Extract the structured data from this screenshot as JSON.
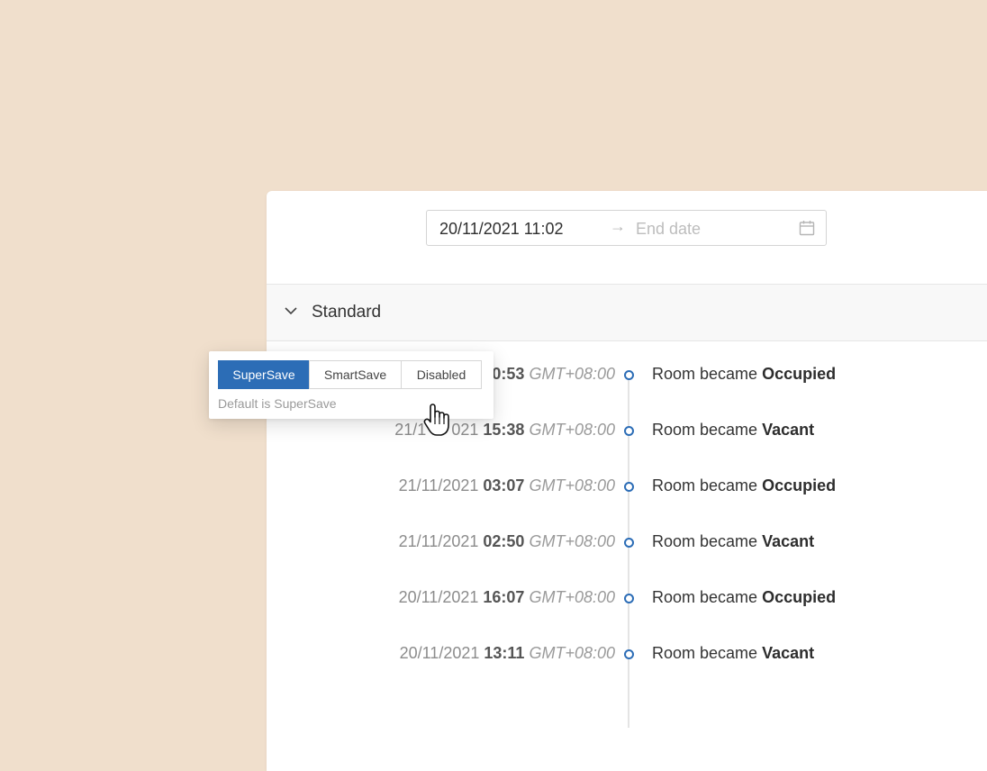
{
  "date_range": {
    "start_value": "20/11/2021 11:02",
    "arrow_glyph": "→",
    "end_placeholder": "End date",
    "calendar_icon": "calendar-icon"
  },
  "section": {
    "title": "Standard",
    "toggle_icon": "chevron-down-icon"
  },
  "events": [
    {
      "date": "",
      "time": "0:53",
      "tz": "GMT+08:00",
      "prefix": "Room became ",
      "status": "Occupied"
    },
    {
      "date": "21/1",
      "time": "15:38",
      "tz": "GMT+08:00",
      "prefix": "Room became ",
      "status": "Vacant",
      "date_tail": "021"
    },
    {
      "date": "21/11/2021",
      "time": "03:07",
      "tz": "GMT+08:00",
      "prefix": "Room became ",
      "status": "Occupied"
    },
    {
      "date": "21/11/2021",
      "time": "02:50",
      "tz": "GMT+08:00",
      "prefix": "Room became ",
      "status": "Vacant"
    },
    {
      "date": "20/11/2021",
      "time": "16:07",
      "tz": "GMT+08:00",
      "prefix": "Room became ",
      "status": "Occupied"
    },
    {
      "date": "20/11/2021",
      "time": "13:11",
      "tz": "GMT+08:00",
      "prefix": "Room became ",
      "status": "Vacant"
    }
  ],
  "mode_popover": {
    "options": [
      "SuperSave",
      "SmartSave",
      "Disabled"
    ],
    "selected": "SuperSave",
    "hint": "Default is SuperSave"
  },
  "colors": {
    "accent": "#2c6db6",
    "background": "#f0dfcc"
  }
}
